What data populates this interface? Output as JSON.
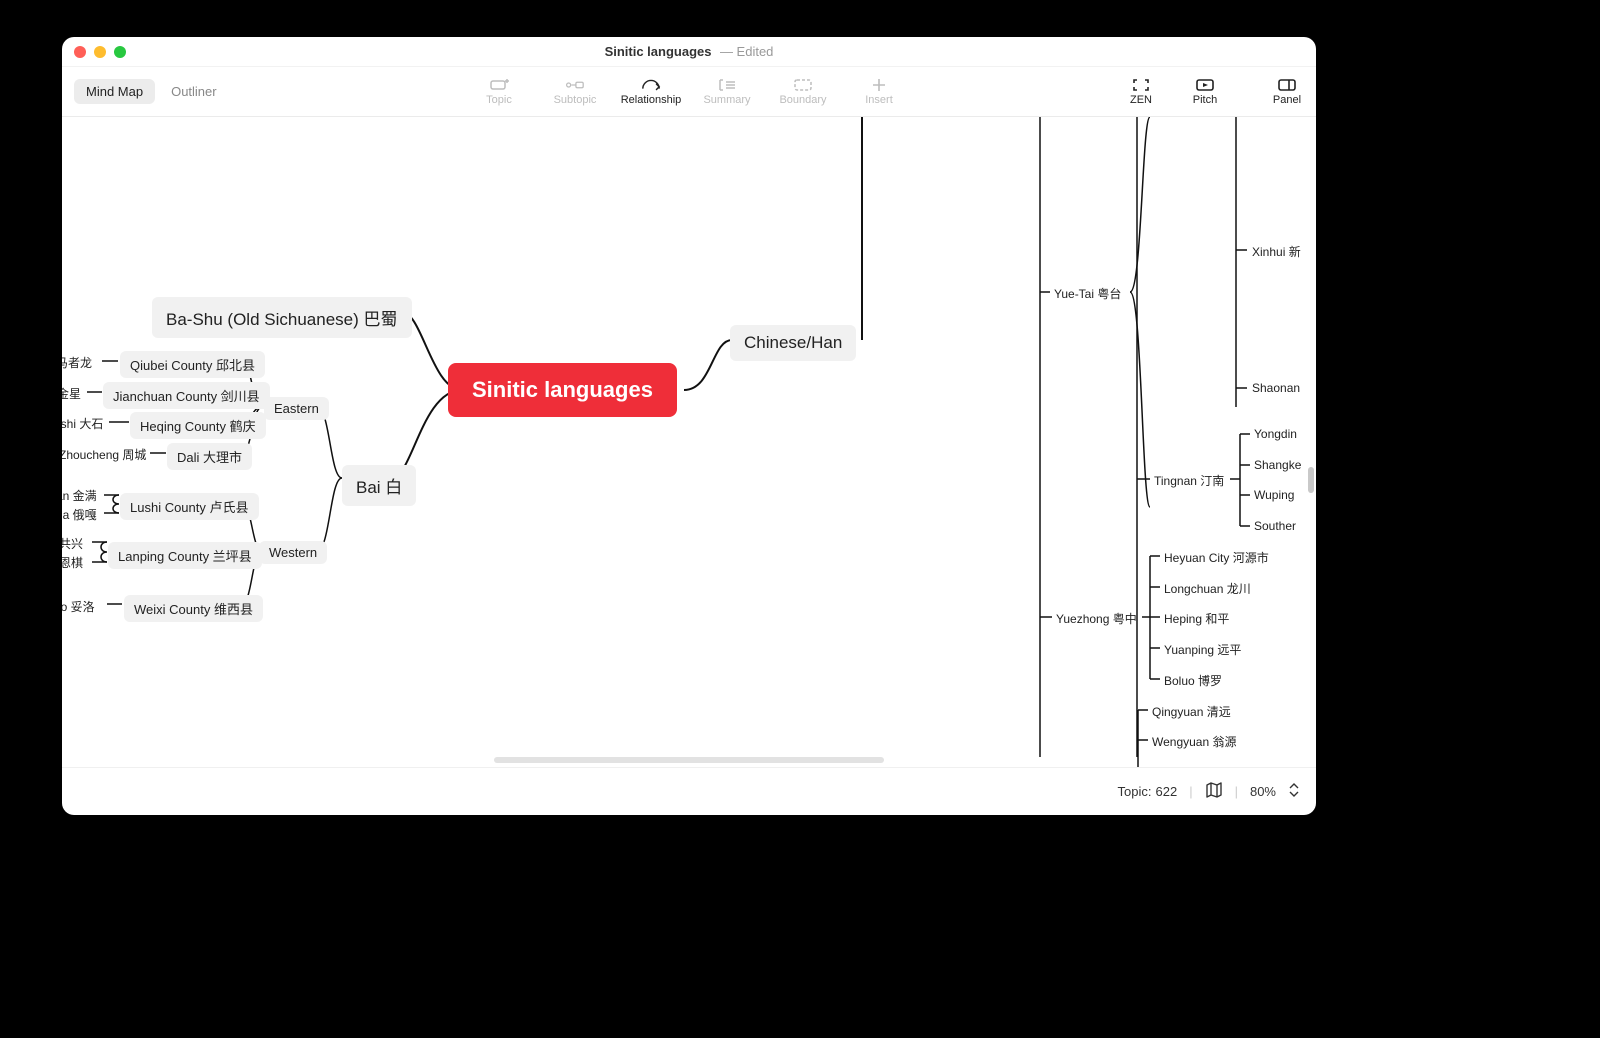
{
  "window": {
    "title": "Sinitic languages",
    "edited_suffix": "— Edited"
  },
  "views": {
    "mind_map": "Mind Map",
    "outliner": "Outliner"
  },
  "tools": {
    "topic": "Topic",
    "subtopic": "Subtopic",
    "relationship": "Relationship",
    "summary": "Summary",
    "boundary": "Boundary",
    "insert": "Insert",
    "zen": "ZEN",
    "pitch": "Pitch",
    "panel": "Panel"
  },
  "status": {
    "topic_label": "Topic:",
    "topic_count": "622",
    "zoom": "80%"
  },
  "map": {
    "root": "Sinitic languages",
    "left_children": [
      {
        "label": "Ba-Shu (Old Sichuanese) 巴蜀"
      },
      {
        "label": "Bai 白",
        "children": [
          {
            "label": "Eastern",
            "children": [
              {
                "label": "Qiubei County 邱北县",
                "leaves": [
                  "马者龙"
                ]
              },
              {
                "label": "Jianchuan County 剑川县",
                "leaves": [
                  "金星"
                ]
              },
              {
                "label": "Heqing County 鹤庆",
                "leaves": [
                  "ashi 大石"
                ]
              },
              {
                "label": "Dali 大理市",
                "leaves": [
                  "Zhoucheng 周城"
                ]
              }
            ]
          },
          {
            "label": "Western",
            "children": [
              {
                "label": "Lushi County 卢氏县",
                "leaves": [
                  "an 金满",
                  "ga 俄嘎"
                ]
              },
              {
                "label": "Lanping County 兰坪县",
                "leaves": [
                  "共兴",
                  "恩棋"
                ]
              },
              {
                "label": "Weixi County 维西县",
                "leaves": [
                  "uo 妥洛"
                ]
              }
            ]
          }
        ]
      }
    ],
    "right_children": [
      {
        "label": "Chinese/Han",
        "groups": [
          {
            "label": "Yue-Tai 粤台",
            "leaves": [
              "Xinhui 新",
              "Shaonan"
            ]
          },
          {
            "label": "Tingnan 汀南",
            "leaves": [
              "Yongdin",
              "Shangke",
              "Wuping",
              "Souther"
            ]
          },
          {
            "label": "Yuezhong 粤中",
            "leaves": [
              "Heyuan City 河源市",
              "Longchuan 龙川",
              "Heping 和平",
              "Yuanping 远平",
              "Boluo 博罗"
            ]
          },
          {
            "label": "",
            "leaves": [
              "Qingyuan 清远",
              "Wengyuan 翁源"
            ]
          }
        ]
      }
    ]
  }
}
